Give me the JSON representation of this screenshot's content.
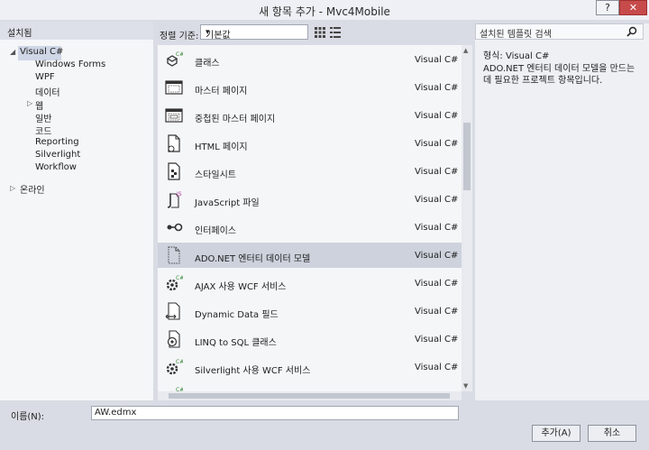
{
  "window": {
    "title": "새 항목 추가 - Mvc4Mobile",
    "help_label": "?",
    "close_label": "✕"
  },
  "sidebar": {
    "header": "설치됨",
    "root": "Visual C#",
    "items": [
      "Windows Forms",
      "WPF",
      "데이터",
      "웹",
      "일반",
      "코드",
      "Reporting",
      "Silverlight",
      "Workflow"
    ],
    "online": "온라인"
  },
  "toolbar": {
    "sort_label": "정렬 기준:",
    "sort_value": "기본값"
  },
  "templates": [
    {
      "name": "클래스",
      "type": "Visual C#",
      "icon": "class-icon"
    },
    {
      "name": "마스터 페이지",
      "type": "Visual C#",
      "icon": "master-page-icon"
    },
    {
      "name": "중첩된 마스터 페이지",
      "type": "Visual C#",
      "icon": "nested-master-page-icon"
    },
    {
      "name": "HTML 페이지",
      "type": "Visual C#",
      "icon": "html-page-icon"
    },
    {
      "name": "스타일시트",
      "type": "Visual C#",
      "icon": "stylesheet-icon"
    },
    {
      "name": "JavaScript 파일",
      "type": "Visual C#",
      "icon": "javascript-file-icon"
    },
    {
      "name": "인터페이스",
      "type": "Visual C#",
      "icon": "interface-icon"
    },
    {
      "name": "ADO.NET 엔터티 데이터 모델",
      "type": "Visual C#",
      "icon": "ado-net-model-icon",
      "selected": true
    },
    {
      "name": "AJAX 사용 WCF 서비스",
      "type": "Visual C#",
      "icon": "wcf-service-icon"
    },
    {
      "name": "Dynamic Data 필드",
      "type": "Visual C#",
      "icon": "dynamic-data-field-icon"
    },
    {
      "name": "LINQ to SQL 클래스",
      "type": "Visual C#",
      "icon": "linq-to-sql-icon"
    },
    {
      "name": "Silverlight 사용 WCF 서비스",
      "type": "Visual C#",
      "icon": "silverlight-wcf-icon"
    }
  ],
  "search": {
    "placeholder": "설치된 템플릿 검색"
  },
  "details": {
    "type_label": "형식:",
    "type_value": "Visual C#",
    "description": "ADO.NET 엔터티 데이터 모델을 만드는 데 필요한 프로젝트 항목입니다."
  },
  "footer": {
    "name_label": "이름(N):",
    "name_value": "AW.edmx",
    "add_label": "추가(A)",
    "cancel_label": "취소"
  }
}
